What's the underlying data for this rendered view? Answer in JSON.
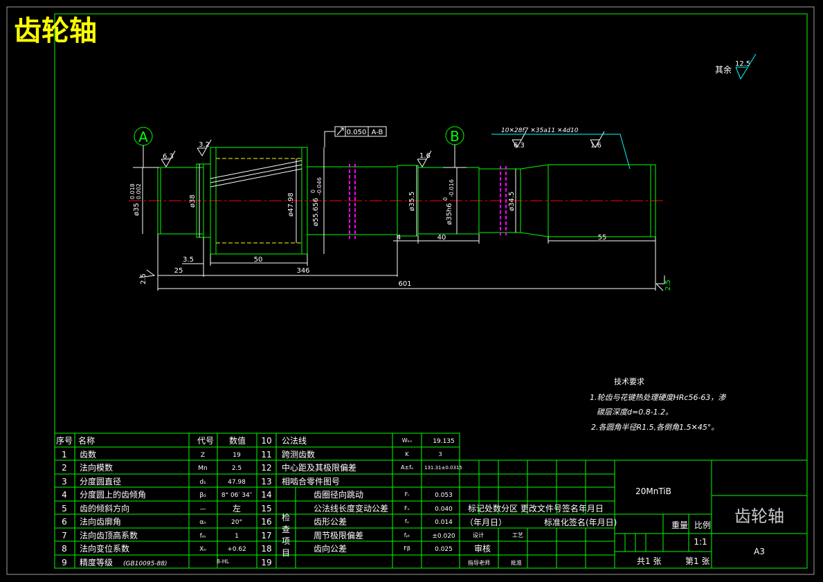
{
  "title": "齿轮轴",
  "surface_roughness_default": {
    "label": "其余",
    "value": "12.5"
  },
  "datums": {
    "a": "A",
    "b": "B"
  },
  "runout_tolerance": {
    "value": "0.050",
    "datum": "A-B"
  },
  "roughness_marks": [
    "6.3",
    "3.2",
    "1.6",
    "6.3",
    "1.6",
    "2.5",
    "2.5"
  ],
  "spline_spec": "10✕28f7 ✕35a11 ✕4d10",
  "diameter_labels": {
    "journal_a": "ø35",
    "journal_a_tol_upper": "0.018",
    "journal_a_tol_lower": "0.002",
    "shoulder": "ø38",
    "gear_pitch": "ø47.98",
    "gear_tip": "ø55.656",
    "gear_tip_tol_upper": "0",
    "gear_tip_tol_lower": "-0.046",
    "collar": "ø35.5",
    "journal_b": "ø35h6",
    "journal_b_tol_upper": "0",
    "journal_b_tol_lower": "-0.016",
    "neck": "ø34.5"
  },
  "length_labels": {
    "l_3_5": "3.5",
    "l_25": "25",
    "l_50": "50",
    "l_346": "346",
    "l_601": "601",
    "l_4": "4",
    "l_40": "40",
    "l_55": "55"
  },
  "tech_requirements": {
    "heading": "技术要求",
    "line1": "1.轮齿与花键热处理硬度HRc56-63，渗",
    "line2": "碳层深度d=0.8-1.2。",
    "line3": "2.各圆角半径R1.5,各倒角1.5✕45°。"
  },
  "params_table": {
    "headers": [
      "序号",
      "名称",
      "代号",
      "数值"
    ],
    "left_rows": [
      {
        "no": "1",
        "name": "齿数",
        "code": "Z",
        "value": "19"
      },
      {
        "no": "2",
        "name": "法向模数",
        "code": "Mn",
        "value": "2.5"
      },
      {
        "no": "3",
        "name": "分度圆直径",
        "code": "d₁",
        "value": "47.98"
      },
      {
        "no": "4",
        "name": "分度圆上的齿倾角",
        "code": "β₀",
        "value": "8° 06′ 34″"
      },
      {
        "no": "5",
        "name": "齿的倾斜方向",
        "code": "—",
        "value": "左"
      },
      {
        "no": "6",
        "name": "法向齿廓角",
        "code": "αₙ",
        "value": "20°"
      },
      {
        "no": "7",
        "name": "法向齿顶高系数",
        "code": "fₘ",
        "value": "1"
      },
      {
        "no": "8",
        "name": "法向变位系数",
        "code": "Xₙ",
        "value": "+0.62"
      },
      {
        "no": "9",
        "name": "精度等级",
        "note": "(GB10095-88)",
        "code": "",
        "value": "8-HL"
      }
    ],
    "right_rows": [
      {
        "no": "10",
        "name": "公法线",
        "code": "Wₖₙ",
        "value": "19.135"
      },
      {
        "no": "11",
        "name": "跨测齿数",
        "code": "K",
        "value": "3"
      },
      {
        "no": "12",
        "name": "中心距及其极限偏差",
        "code": "A±fₐ",
        "value": "131.31±0.0315"
      },
      {
        "no": "13",
        "name": "相啮合零件图号",
        "code": "",
        "value": ""
      },
      {
        "no": "14",
        "name": "齿圈径向跳动",
        "code": "Fᵣ",
        "value": "0.053"
      },
      {
        "no": "15",
        "name": "公法线长度变动公差",
        "code": "Fᵥ",
        "value": "0.040"
      },
      {
        "no": "16",
        "name": "齿形公差",
        "code": "fₓ",
        "value": "0.014"
      },
      {
        "no": "17",
        "name": "周节极限偏差",
        "code": "fₚₜ",
        "value": "±0.020"
      },
      {
        "no": "18",
        "name": "齿向公差",
        "code": "Fβ",
        "value": "0.025"
      },
      {
        "no": "19",
        "name": "",
        "code": "",
        "value": ""
      }
    ],
    "inspect_label": [
      "检",
      "查",
      "项",
      "目"
    ]
  },
  "title_block": {
    "material": "20MnTiB",
    "part_name": "齿轮轴",
    "sheet_size": "A3",
    "rev_header": "标记处数分区 更改文件号签名年月日",
    "date_label": "（年月日）",
    "std_sign": "标准化签名(年月日)",
    "design": "设计",
    "process": "工艺",
    "review": "审核",
    "chief": "指导老师",
    "approve": "批准",
    "weight": "重量",
    "scale_label": "比例",
    "scale_value": "1:1",
    "sheets_total": "共1 张",
    "sheet_no": "第1 张"
  },
  "colors": {
    "frame": "#00ff00",
    "text": "#ffffff",
    "shaft": "#00ff00",
    "centerline": "#ff0000",
    "dimension": "#00ffff",
    "hidden": "#ffff00",
    "spline_marks": "#ff00ff",
    "title": "#ffff00"
  }
}
